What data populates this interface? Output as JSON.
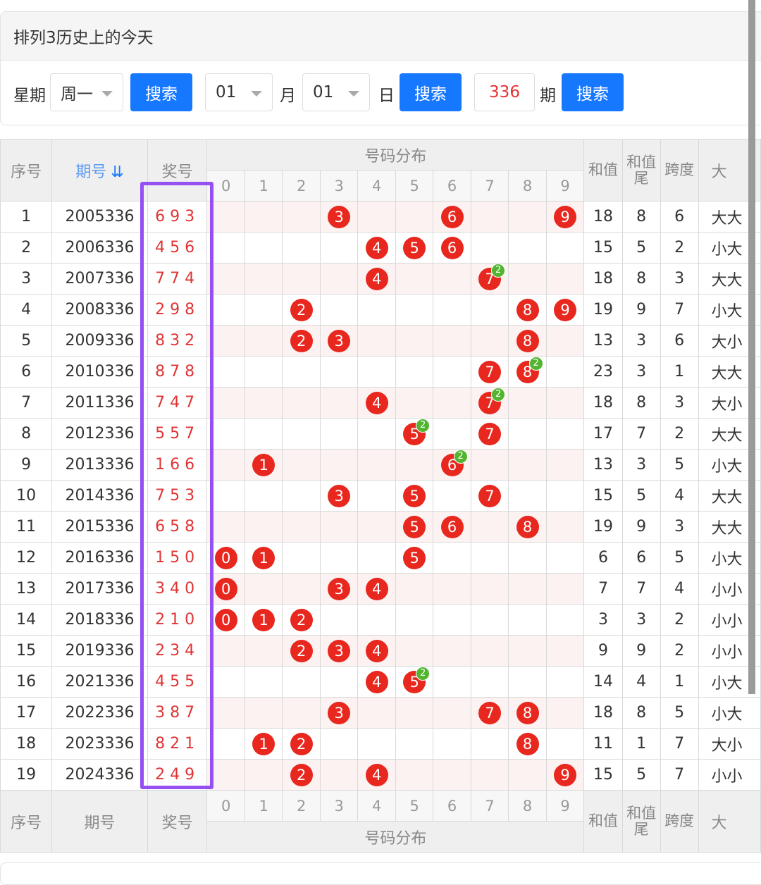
{
  "header": {
    "title": "排列3历史上的今天"
  },
  "search": {
    "weekday_label": "星期",
    "weekday_value": "周一",
    "month_value": "01",
    "month_label": "月",
    "day_value": "01",
    "day_label": "日",
    "issue_value": "336",
    "issue_label": "期",
    "button_label": "搜索"
  },
  "table": {
    "col_seq": "序号",
    "col_issue": "期号",
    "sort_icon": "⇊",
    "col_award": "奖号",
    "col_dist": "号码分布",
    "col_sum": "和值",
    "col_sum_tail": "和值尾",
    "col_span": "跨度",
    "col_size": "大",
    "digits": [
      "0",
      "1",
      "2",
      "3",
      "4",
      "5",
      "6",
      "7",
      "8",
      "9"
    ],
    "rows": [
      {
        "seq": "1",
        "issue": "2005336",
        "award": "693",
        "sum": "18",
        "tail": "8",
        "span": "6",
        "size": "大大"
      },
      {
        "seq": "2",
        "issue": "2006336",
        "award": "456",
        "sum": "15",
        "tail": "5",
        "span": "2",
        "size": "小大"
      },
      {
        "seq": "3",
        "issue": "2007336",
        "award": "774",
        "sum": "18",
        "tail": "8",
        "span": "3",
        "size": "大大"
      },
      {
        "seq": "4",
        "issue": "2008336",
        "award": "298",
        "sum": "19",
        "tail": "9",
        "span": "7",
        "size": "小大"
      },
      {
        "seq": "5",
        "issue": "2009336",
        "award": "832",
        "sum": "13",
        "tail": "3",
        "span": "6",
        "size": "大小"
      },
      {
        "seq": "6",
        "issue": "2010336",
        "award": "878",
        "sum": "23",
        "tail": "3",
        "span": "1",
        "size": "大大"
      },
      {
        "seq": "7",
        "issue": "2011336",
        "award": "747",
        "sum": "18",
        "tail": "8",
        "span": "3",
        "size": "大小"
      },
      {
        "seq": "8",
        "issue": "2012336",
        "award": "557",
        "sum": "17",
        "tail": "7",
        "span": "2",
        "size": "大大"
      },
      {
        "seq": "9",
        "issue": "2013336",
        "award": "166",
        "sum": "13",
        "tail": "3",
        "span": "5",
        "size": "小大"
      },
      {
        "seq": "10",
        "issue": "2014336",
        "award": "753",
        "sum": "15",
        "tail": "5",
        "span": "4",
        "size": "大大"
      },
      {
        "seq": "11",
        "issue": "2015336",
        "award": "658",
        "sum": "19",
        "tail": "9",
        "span": "3",
        "size": "大大"
      },
      {
        "seq": "12",
        "issue": "2016336",
        "award": "150",
        "sum": "6",
        "tail": "6",
        "span": "5",
        "size": "小大"
      },
      {
        "seq": "13",
        "issue": "2017336",
        "award": "340",
        "sum": "7",
        "tail": "7",
        "span": "4",
        "size": "小小"
      },
      {
        "seq": "14",
        "issue": "2018336",
        "award": "210",
        "sum": "3",
        "tail": "3",
        "span": "2",
        "size": "小小"
      },
      {
        "seq": "15",
        "issue": "2019336",
        "award": "234",
        "sum": "9",
        "tail": "9",
        "span": "2",
        "size": "小小"
      },
      {
        "seq": "16",
        "issue": "2021336",
        "award": "455",
        "sum": "14",
        "tail": "4",
        "span": "1",
        "size": "小大"
      },
      {
        "seq": "17",
        "issue": "2022336",
        "award": "387",
        "sum": "18",
        "tail": "8",
        "span": "5",
        "size": "小大"
      },
      {
        "seq": "18",
        "issue": "2023336",
        "award": "821",
        "sum": "11",
        "tail": "1",
        "span": "7",
        "size": "大小"
      },
      {
        "seq": "19",
        "issue": "2024336",
        "award": "249",
        "sum": "15",
        "tail": "5",
        "span": "7",
        "size": "小小"
      }
    ]
  },
  "colors": {
    "accent": "#1677ff",
    "ball": "#e8271e",
    "repeat_badge": "#51b530",
    "highlight": "#9650f2",
    "award_text": "#e03434"
  }
}
